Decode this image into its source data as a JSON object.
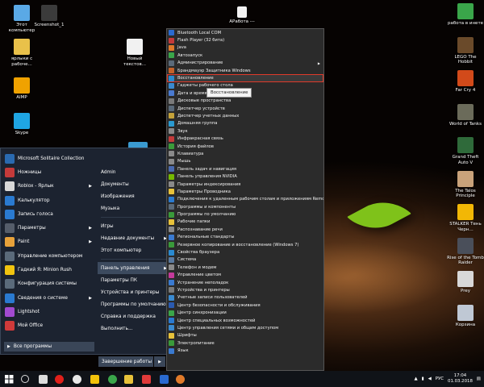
{
  "desktop_icons_left": [
    {
      "label": "Этот компьютер",
      "color": "#5aa9e6"
    },
    {
      "label": "Screenshot_1",
      "color": "#3b3b3b"
    },
    {
      "label": "ярлыки с рабоче...",
      "color": "#e9c14a"
    },
    {
      "label": "Новый текстов...",
      "color": "#f1f1f1"
    },
    {
      "label": "AIMP",
      "color": "#f0a200"
    },
    {
      "label": "Skype",
      "color": "#1fa5e3"
    }
  ],
  "desktop_icons_right": [
    {
      "label": "работа в инете",
      "color": "#3aa64a"
    },
    {
      "label": "LEGO The Hobbit",
      "color": "#6a4a2a"
    },
    {
      "label": "Far Cry 4",
      "color": "#d24a1a"
    },
    {
      "label": "World of Tanks",
      "color": "#6b6b5a"
    },
    {
      "label": "Grand Theft Auto V",
      "color": "#2f6a3a"
    },
    {
      "label": "The Talos Principle",
      "color": "#c9a27a"
    },
    {
      "label": "STALKER Тень Черн...",
      "color": "#f2b705"
    },
    {
      "label": "Rise of the Tomb Raider",
      "color": "#4a4f5a"
    },
    {
      "label": "Prey",
      "color": "#d8d8d8"
    },
    {
      "label": "Корзина",
      "color": "#bfc8d4"
    }
  ],
  "top_file": {
    "label": "АРабота ---"
  },
  "start_programs": [
    {
      "label": "Microsoft Solitaire Collection",
      "color": "#2a6ab0"
    },
    {
      "label": "Ножницы",
      "color": "#c43a3a"
    },
    {
      "label": "Roblox - Ярлык",
      "color": "#d8d8d8",
      "arrow": "▶"
    },
    {
      "label": "Калькулятор",
      "color": "#2a7ad0"
    },
    {
      "label": "Запись голоса",
      "color": "#2a7ad0"
    },
    {
      "label": "Параметры",
      "color": "#555d6a",
      "arrow": "▶"
    },
    {
      "label": "Paint",
      "color": "#e8a23a",
      "arrow": "▶"
    },
    {
      "label": "Управление компьютером",
      "color": "#5a6a7a"
    },
    {
      "label": "Гадкий Я: Minion Rush",
      "color": "#f1c40f"
    },
    {
      "label": "Конфигурация системы",
      "color": "#5a6a7a"
    },
    {
      "label": "Сведения о системе",
      "color": "#2a7ad0",
      "arrow": "▶"
    },
    {
      "label": "Lightshot",
      "color": "#a24ad0"
    },
    {
      "label": "Мой Office",
      "color": "#d03a3a"
    }
  ],
  "all_programs": "Все программы",
  "start_right": [
    {
      "label": "Admin"
    },
    {
      "label": "Документы"
    },
    {
      "label": "Изображения"
    },
    {
      "label": "Музыка"
    },
    {
      "sep": true
    },
    {
      "label": "Игры"
    },
    {
      "label": "Недавние документы",
      "arrow": "▶"
    },
    {
      "label": "Этот компьютер"
    },
    {
      "sep": true
    },
    {
      "label": "Панель управления",
      "arrow": "▶",
      "active": true
    },
    {
      "label": "Параметры ПК"
    },
    {
      "label": "Устройства и принтеры"
    },
    {
      "label": "Программы по умолчанию"
    },
    {
      "label": "Справка и поддержка"
    },
    {
      "label": "Выполнить..."
    }
  ],
  "shutdown": {
    "label": "Завершение работы",
    "arrow": "▶"
  },
  "control_panel": [
    {
      "label": "Bluetooth Local COM",
      "color": "#2a6ad0"
    },
    {
      "label": "Flash Player (32 бита)",
      "color": "#c43a3a"
    },
    {
      "label": "Java",
      "color": "#e07a2a"
    },
    {
      "label": "Автозапуск",
      "color": "#3aa64a"
    },
    {
      "label": "Администрирование",
      "color": "#5a6a7a",
      "arrow": "▶"
    },
    {
      "label": "Брандмауэр Защитника Windows",
      "color": "#c4622a"
    },
    {
      "label": "Восстановление",
      "color": "#2a8ad0",
      "hl": true
    },
    {
      "label": "Гаджеты рабочего стола",
      "color": "#3a8ad0"
    },
    {
      "label": "Дата и время",
      "color": "#4a7ad0"
    },
    {
      "label": "Дисковые пространства",
      "color": "#7a7a7a"
    },
    {
      "label": "Диспетчер устройств",
      "color": "#5a6a7a"
    },
    {
      "label": "Диспетчер учетных данных",
      "color": "#c4a23a"
    },
    {
      "label": "Домашняя группа",
      "color": "#2a9ad0"
    },
    {
      "label": "Звук",
      "color": "#8a8a8a"
    },
    {
      "label": "Инфракрасная связь",
      "color": "#c43a3a"
    },
    {
      "label": "История файлов",
      "color": "#3a9a3a"
    },
    {
      "label": "Клавиатура",
      "color": "#8a8a8a"
    },
    {
      "label": "Мышь",
      "color": "#8a8a8a"
    },
    {
      "label": "Панель задач и навигация",
      "color": "#4a6ab0"
    },
    {
      "label": "Панель управления NVIDIA",
      "color": "#76b900"
    },
    {
      "label": "Параметры индексирования",
      "color": "#8a8a8a"
    },
    {
      "label": "Параметры Проводника",
      "color": "#e8c23a"
    },
    {
      "label": "Подключения к удаленным рабочим столам и приложениям RemoteApp",
      "color": "#2a7ad0"
    },
    {
      "label": "Программы и компоненты",
      "color": "#5a6a7a"
    },
    {
      "label": "Программы по умолчанию",
      "color": "#3a9a3a"
    },
    {
      "label": "Рабочие папки",
      "color": "#e8c23a"
    },
    {
      "label": "Распознавание речи",
      "color": "#8a8a8a"
    },
    {
      "label": "Региональные стандарты",
      "color": "#3a7ad0"
    },
    {
      "label": "Резервное копирование и восстановление (Windows 7)",
      "color": "#3a9a3a"
    },
    {
      "label": "Свойства браузера",
      "color": "#2a8ad0"
    },
    {
      "label": "Система",
      "color": "#5a7aa0"
    },
    {
      "label": "Телефон и модем",
      "color": "#8a8a8a"
    },
    {
      "label": "Управление цветом",
      "color": "#c43a9a"
    },
    {
      "label": "Устранение неполадок",
      "color": "#3a7ad0"
    },
    {
      "label": "Устройства и принтеры",
      "color": "#7a7a7a"
    },
    {
      "label": "Учетные записи пользователей",
      "color": "#3a8ad0"
    },
    {
      "label": "Центр безопасности и обслуживания",
      "color": "#2a5ab0"
    },
    {
      "label": "Центр синхронизации",
      "color": "#3aa64a"
    },
    {
      "label": "Центр специальных возможностей",
      "color": "#2a7ad0"
    },
    {
      "label": "Центр управления сетями и общим доступом",
      "color": "#3a8ad0"
    },
    {
      "label": "Шрифты",
      "color": "#e8c23a"
    },
    {
      "label": "Электропитание",
      "color": "#3a9a3a"
    },
    {
      "label": "Язык",
      "color": "#3a7ad0"
    }
  ],
  "tooltip": "Восстановление",
  "taskbar": {
    "apps": [
      {
        "name": "start-button",
        "color": "#ffffff"
      },
      {
        "name": "search-button",
        "color": "#dddddd"
      },
      {
        "name": "task-view-button",
        "color": "#dddddd"
      },
      {
        "name": "opera-icon",
        "color": "#e0201a"
      },
      {
        "name": "yandex-browser-icon",
        "color": "#e8e8e8"
      },
      {
        "name": "yandex-icon",
        "color": "#f2c20a"
      },
      {
        "name": "chrome-icon",
        "color": "#3aa64a"
      },
      {
        "name": "explorer-icon",
        "color": "#e8c23a"
      },
      {
        "name": "app-icon",
        "color": "#e03a3a"
      },
      {
        "name": "app-icon-2",
        "color": "#2a6ad0"
      },
      {
        "name": "firefox-icon",
        "color": "#e07a2a"
      }
    ],
    "lang": "РУС",
    "time": "17:04",
    "date": "01.03.2018"
  }
}
